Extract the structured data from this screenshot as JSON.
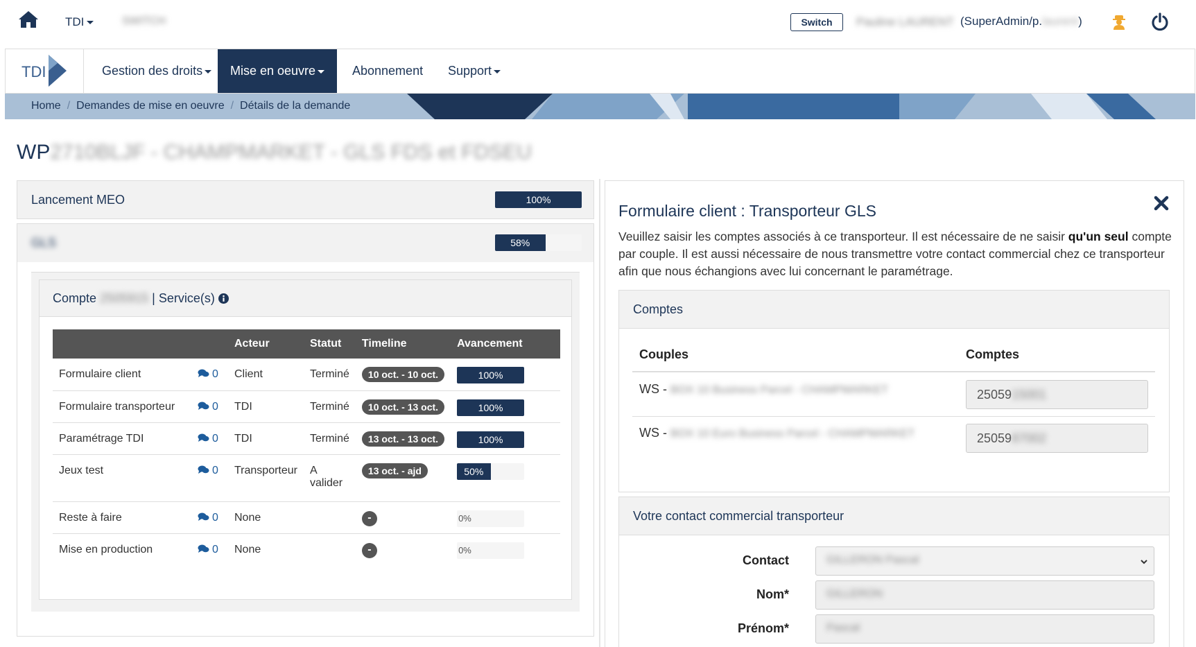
{
  "topbar": {
    "org_label": "TDI",
    "org_sub": "SWITCH",
    "switch_label": "Switch",
    "user_name": "Pauline LAURENT",
    "user_role_prefix": "(SuperAdmin/p.",
    "user_role_blur": "laurent",
    "user_role_suffix": ")"
  },
  "navbar": {
    "brand": "TDI",
    "items": [
      {
        "label": "Gestion des droits"
      },
      {
        "label": "Mise en oeuvre"
      },
      {
        "label": "Abonnement"
      },
      {
        "label": "Support"
      }
    ]
  },
  "breadcrumb": [
    "Home",
    "Demandes de mise en oeuvre",
    "Détails de la demande"
  ],
  "page": {
    "title_prefix": "WP",
    "title_blur": "2710BLJF - CHAMPMARKET - GLS FDS et FDSEU"
  },
  "phases": [
    {
      "label": "Lancement MEO",
      "progress": 100,
      "progress_label": "100%"
    },
    {
      "label": "GLS",
      "progress": 58,
      "progress_label": "58%"
    }
  ],
  "compte": {
    "prefix": "Compte",
    "number": "2505915",
    "suffix": "| Service(s)"
  },
  "steps_table": {
    "headers": [
      "",
      "",
      "Acteur",
      "Statut",
      "Timeline",
      "Avancement"
    ],
    "rows": [
      {
        "name": "Formulaire client",
        "comments": "0",
        "actor": "Client",
        "status": "Terminé",
        "timeline": "10 oct. - 10 oct.",
        "progress": 100,
        "progress_label": "100%"
      },
      {
        "name": "Formulaire transporteur",
        "comments": "0",
        "actor": "TDI",
        "status": "Terminé",
        "timeline": "10 oct. - 13 oct.",
        "progress": 100,
        "progress_label": "100%"
      },
      {
        "name": "Paramétrage TDI",
        "comments": "0",
        "actor": "TDI",
        "status": "Terminé",
        "timeline": "13 oct. - 13 oct.",
        "progress": 100,
        "progress_label": "100%"
      },
      {
        "name": "Jeux test",
        "comments": "0",
        "actor": "Transporteur",
        "status": "A valider",
        "timeline": "13 oct. - ajd",
        "progress": 50,
        "progress_label": "50%"
      },
      {
        "name": "Reste à faire",
        "comments": "0",
        "actor": "None",
        "status": "",
        "timeline": "-",
        "progress": 0,
        "progress_label": "0%"
      },
      {
        "name": "Mise en production",
        "comments": "0",
        "actor": "None",
        "status": "",
        "timeline": "-",
        "progress": 0,
        "progress_label": "0%"
      }
    ]
  },
  "form": {
    "title": "Formulaire client : Transporteur GLS",
    "desc_1": "Veuillez saisir les comptes associés à ce transporteur. Il est nécessaire de ne saisir ",
    "desc_bold": "qu'un seul",
    "desc_2": " compte par couple. Il est aussi nécessaire de nous transmettre votre contact commercial chez ce transporteur afin que nous échangions avec lui concernant le paramétrage.",
    "comptes_section": "Comptes",
    "col_couples": "Couples",
    "col_comptes": "Comptes",
    "accounts": [
      {
        "prefix": "WS -",
        "blur": "BOX 10 Business Parcel - CHAMPMARKET",
        "value_prefix": "25059",
        "value_blur": "15001"
      },
      {
        "prefix": "WS -",
        "blur": "BOX 10 Euro Business Parcel - CHAMPMARKET",
        "value_prefix": "25059",
        "value_blur": "87002"
      }
    ],
    "contact_section": "Votre contact commercial transporteur",
    "contact_label": "Contact",
    "contact_value": "GILLERON Pascal",
    "nom_label": "Nom*",
    "nom_value": "GILLERON",
    "prenom_label": "Prénom*",
    "prenom_value": "Pascal"
  },
  "colors": {
    "primary": "#1d3557",
    "table_head": "#555555",
    "panel_bg": "#f2f2f2"
  }
}
